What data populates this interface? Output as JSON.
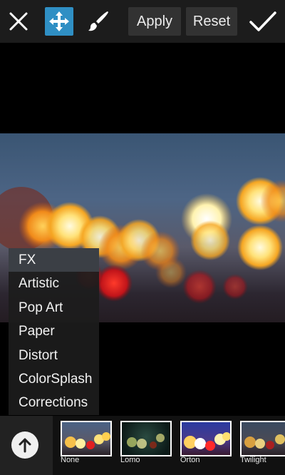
{
  "toolbar": {
    "apply_label": "Apply",
    "reset_label": "Reset",
    "icons": [
      "close-icon",
      "move-icon",
      "brush-icon",
      "checkmark-icon"
    ],
    "move_active_color": "#2f8fc4"
  },
  "menu": {
    "items": [
      "FX",
      "Artistic",
      "Pop Art",
      "Paper",
      "Distort",
      "ColorSplash",
      "Corrections"
    ],
    "selected": "FX"
  },
  "effects": {
    "items": [
      "None",
      "Lomo",
      "Orton",
      "Twilight"
    ]
  },
  "bottom": {
    "up_icon": "arrow-up-icon"
  }
}
